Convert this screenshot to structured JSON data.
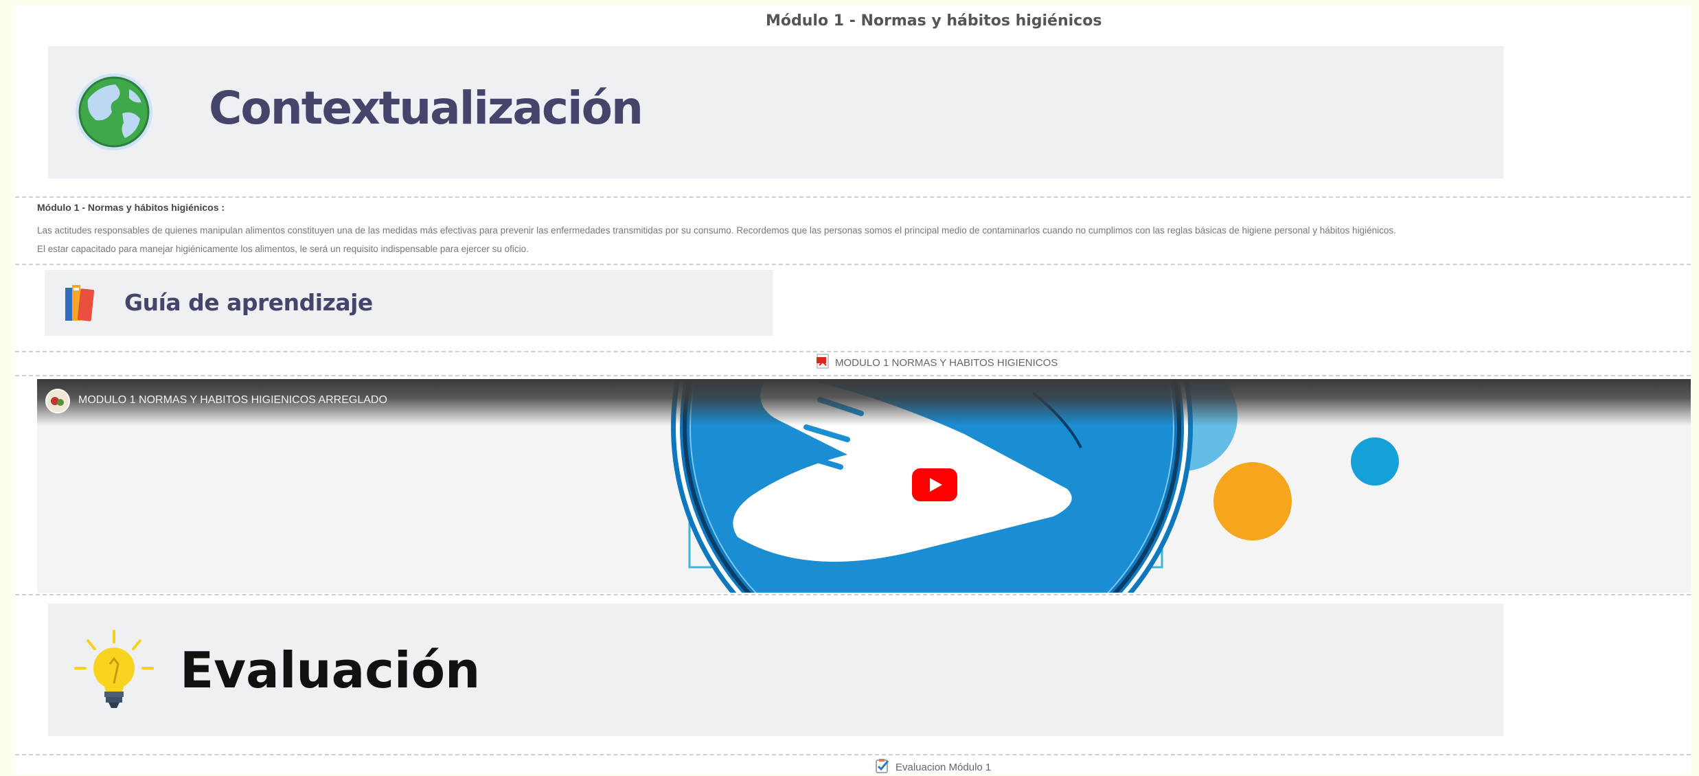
{
  "module_header": "Módulo 1 - Normas y hábitos higiénicos",
  "contextualizacion": {
    "title": "Contextualización",
    "icon": "globe-icon"
  },
  "description": {
    "heading": "Módulo 1 - Normas y hábitos higiénicos :",
    "paragraph_line1": "Las actitudes responsables de quienes manipulan alimentos constituyen una de las medidas más efectivas para prevenir las enfermedades transmitidas por su consumo. Recordemos que las personas somos el principal medio de contaminarlos cuando no cumplimos con las reglas básicas de higiene personal y hábitos higiénicos.",
    "paragraph_line2": "El estar capacitado para manejar higiénicamente los alimentos, le será un requisito indispensable para ejercer su oficio."
  },
  "guia": {
    "title": "Guía de aprendizaje",
    "icon": "books-icon"
  },
  "pdf_link": {
    "label": "MODULO 1 NORMAS Y HABITOS HIGIENICOS",
    "icon": "pdf-icon"
  },
  "video": {
    "title": "MODULO 1 NORMAS Y HABITOS HIGIENICOS ARREGLADO",
    "play_icon": "youtube-play-icon",
    "colors": {
      "blue": "#0f6db5",
      "light_blue": "#15a0d8",
      "orange": "#f6a51c"
    }
  },
  "evaluacion": {
    "title": "Evaluación",
    "icon": "lightbulb-icon"
  },
  "eval_link": {
    "label": "Evaluacion Módulo 1",
    "icon": "checklist-icon"
  }
}
